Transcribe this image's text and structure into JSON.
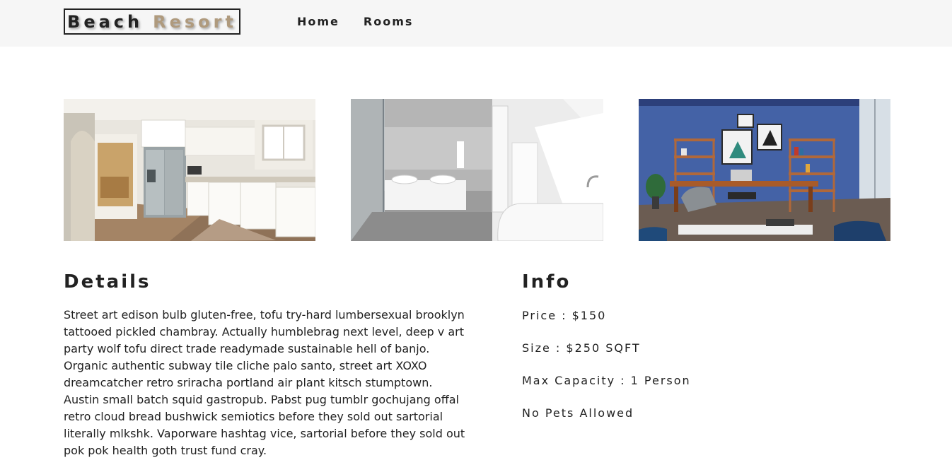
{
  "navbar": {
    "logo_word1": "Beach",
    "logo_word2": "Resort",
    "links": [
      "Home",
      "Rooms"
    ]
  },
  "colors": {
    "accent": "#af9a7d",
    "navbar_bg": "#f6f6f6",
    "text": "#222222"
  },
  "gallery": {
    "images": [
      "kitchen-photo",
      "bathroom-photo",
      "office-living-room-photo"
    ]
  },
  "details": {
    "title": "Details",
    "text": "Street art edison bulb gluten-free, tofu try-hard lumbersexual brooklyn tattooed pickled chambray. Actually humblebrag next level, deep v art party wolf tofu direct trade readymade sustainable hell of banjo. Organic authentic subway tile cliche palo santo, street art XOXO dreamcatcher retro sriracha portland air plant kitsch stumptown. Austin small batch squid gastropub. Pabst pug tumblr gochujang offal retro cloud bread bushwick semiotics before they sold out sartorial literally mlkshk. Vaporware hashtag vice, sartorial before they sold out pok pok health goth trust fund cray."
  },
  "info": {
    "title": "Info",
    "items": [
      "Price : $150",
      "Size : $250 SQFT",
      "Max Capacity : 1 Person",
      "No Pets Allowed"
    ]
  }
}
